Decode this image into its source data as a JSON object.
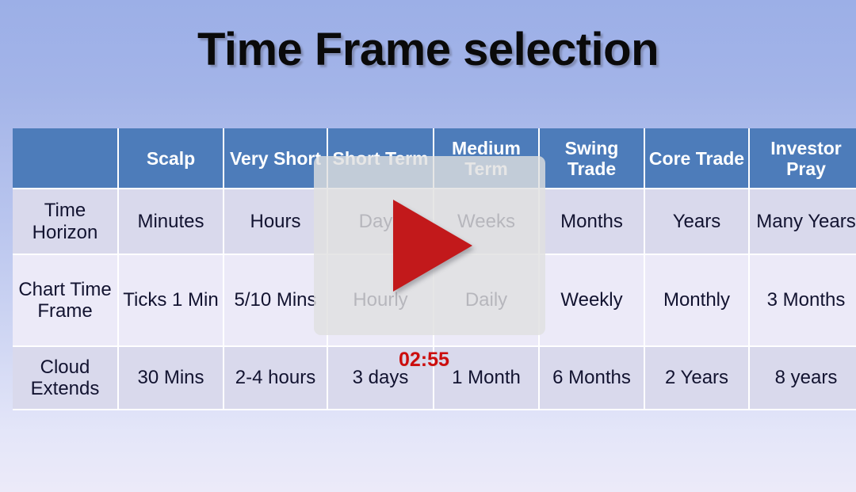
{
  "slide": {
    "title": "Time Frame selection",
    "background_top_color": "#9cafe7",
    "background_bottom_color": "#eceaf9"
  },
  "table": {
    "header_fill": "#4d7cba",
    "header_text_color": "#ffffff",
    "row_fill_a": "#d9d9ec",
    "row_fill_b": "#eceaf8",
    "headers": [
      "",
      "Scalp",
      "Very Short",
      "Short Term",
      "Medium Term",
      "Swing Trade",
      "Core Trade",
      "Investor Pray"
    ],
    "rows": [
      {
        "label": "Time Horizon",
        "cells": [
          "Minutes",
          "Hours",
          "Days",
          "Weeks",
          "Months",
          "Years",
          "Many Years"
        ]
      },
      {
        "label": "Chart Time Frame",
        "cells": [
          "Ticks 1 Min",
          "5/10 Mins",
          "Hourly",
          "Daily",
          "Weekly",
          "Monthly",
          "3 Months"
        ]
      },
      {
        "label": "Cloud Extends",
        "cells": [
          "30 Mins",
          "2-4 hours",
          "3 days",
          "1 Month",
          "6 Months",
          "2 Years",
          "8 years"
        ]
      }
    ]
  },
  "player": {
    "play_icon": "play-triangle-icon",
    "play_color": "#c2191b",
    "timestamp": "02:55",
    "timestamp_color": "#cc0d0d",
    "overlay_color": "rgba(224,224,224,0.80)"
  }
}
